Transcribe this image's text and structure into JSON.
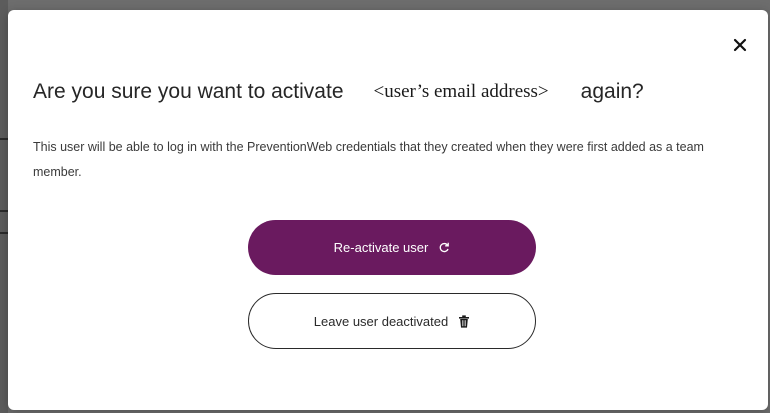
{
  "modal": {
    "title_prefix": "Are you sure you want to activate",
    "email_placeholder": "<user’s email address>",
    "title_suffix": "again?",
    "description": "This user will be able to log in with the PreventionWeb credentials that they created when they were first added as a team member.",
    "close_icon": "close-icon"
  },
  "actions": {
    "reactivate_label": "Re-activate user",
    "reactivate_icon": "refresh-icon",
    "leave_label": "Leave user deactivated",
    "leave_icon": "trash-icon"
  },
  "colors": {
    "primary": "#6a1a5f",
    "overlay": "#6d6d6d"
  }
}
